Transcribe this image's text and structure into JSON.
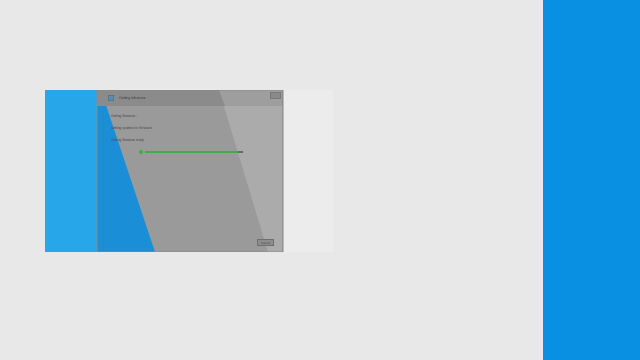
{
  "dialog": {
    "title": "Getting Windows",
    "lines": [
      "Getting Windows…",
      "Getting updates for Windows",
      "Getting Windows ready"
    ],
    "progress": 0.95,
    "cancel_label": "Cancel",
    "icon": "windows-setup-icon"
  },
  "colors": {
    "background": "#e8e8e8",
    "accent": "#0a90e2",
    "progress": "#3fae49"
  }
}
